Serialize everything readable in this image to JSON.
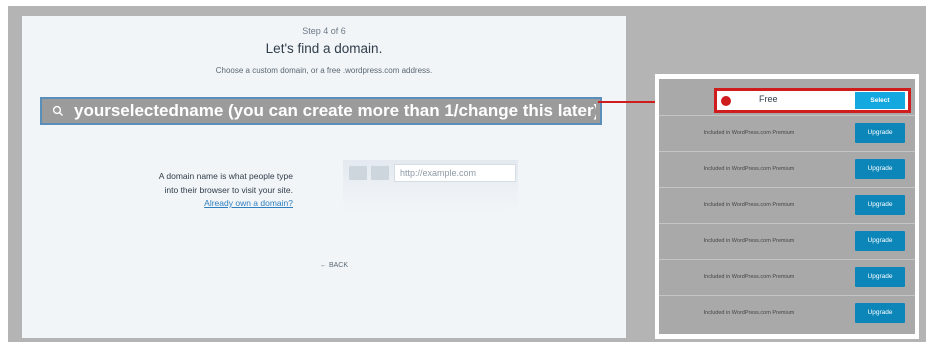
{
  "signup": {
    "step": "Step 4 of 6",
    "title": "Let's find a domain.",
    "subtitle": "Choose a custom domain, or a free .wordpress.com address.",
    "search": {
      "value": "yourselectedname (you can create more than 1/change this later)",
      "icon": "search-icon"
    },
    "info_line1": "A domain name is what people type",
    "info_line2": "into their browser to visit your site.",
    "own_domain_link": "Already own a domain?",
    "example_url": "http://example.com",
    "back_label": "← BACK"
  },
  "domain_list": {
    "selected": {
      "label": "Free",
      "button": "Select"
    },
    "rows": [
      {
        "text": "Included in WordPress.com Premium",
        "button": "Upgrade"
      },
      {
        "text": "Included in WordPress.com Premium",
        "button": "Upgrade"
      },
      {
        "text": "Included in WordPress.com Premium",
        "button": "Upgrade"
      },
      {
        "text": "Included in WordPress.com Premium",
        "button": "Upgrade"
      },
      {
        "text": "Included in WordPress.com Premium",
        "button": "Upgrade"
      },
      {
        "text": "Included in WordPress.com Premium",
        "button": "Upgrade"
      }
    ]
  },
  "colors": {
    "annotation": "#cf1c1c",
    "upgrade_button": "#0c86b9",
    "select_button": "#14a8e0",
    "link": "#2e7fbf"
  }
}
